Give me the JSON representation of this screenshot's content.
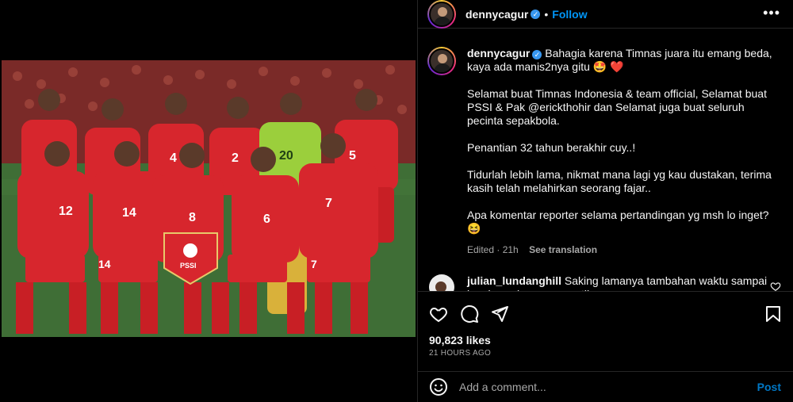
{
  "post": {
    "image_alt": "Team photo of Timnas Indonesia football players in red kits",
    "jersey_numbers": [
      "12",
      "14",
      "8",
      "6",
      "7",
      "2",
      "20",
      "5",
      "4"
    ],
    "pennant_text": "PSSI",
    "brand_color": "#d7262d"
  },
  "header": {
    "username": "dennycagur",
    "verified_icon": "verified-badge-icon",
    "separator": "•",
    "follow_label": "Follow",
    "more_icon": "more-options-icon",
    "more_glyph": "•••"
  },
  "caption": {
    "username": "dennycagur",
    "line1": "Bahagia karena Timnas juara itu emang beda, kaya ada manis2nya gitu 🤩 ❤️",
    "line2": "Selamat buat Timnas Indonesia & team official, Selamat buat PSSI & Pak @erickthohir dan Selamat juga buat seluruh pecinta sepakbola.",
    "line3": "Penantian 32 tahun berakhir cuy..!",
    "line4": "Tidurlah lebih lama, nikmat mana lagi yg kau dustakan, terima kasih telah melahirkan seorang fajar..",
    "line5": "Apa komentar reporter selama pertandingan yg msh lo inget?😆",
    "edited": "Edited · 21h",
    "see_translation": "See translation"
  },
  "comment": {
    "username": "julian_lundanghill",
    "text": "Saking lamanya tambahan waktu sampai kumisnya bagas memutih.."
  },
  "actions": {
    "like_icon": "heart-icon",
    "comment_icon": "comment-icon",
    "share_icon": "share-icon",
    "save_icon": "bookmark-icon"
  },
  "stats": {
    "likes": "90,823 likes",
    "time": "21 HOURS AGO"
  },
  "add_comment": {
    "placeholder": "Add a comment...",
    "post_label": "Post",
    "emoji_icon": "emoji-icon"
  }
}
